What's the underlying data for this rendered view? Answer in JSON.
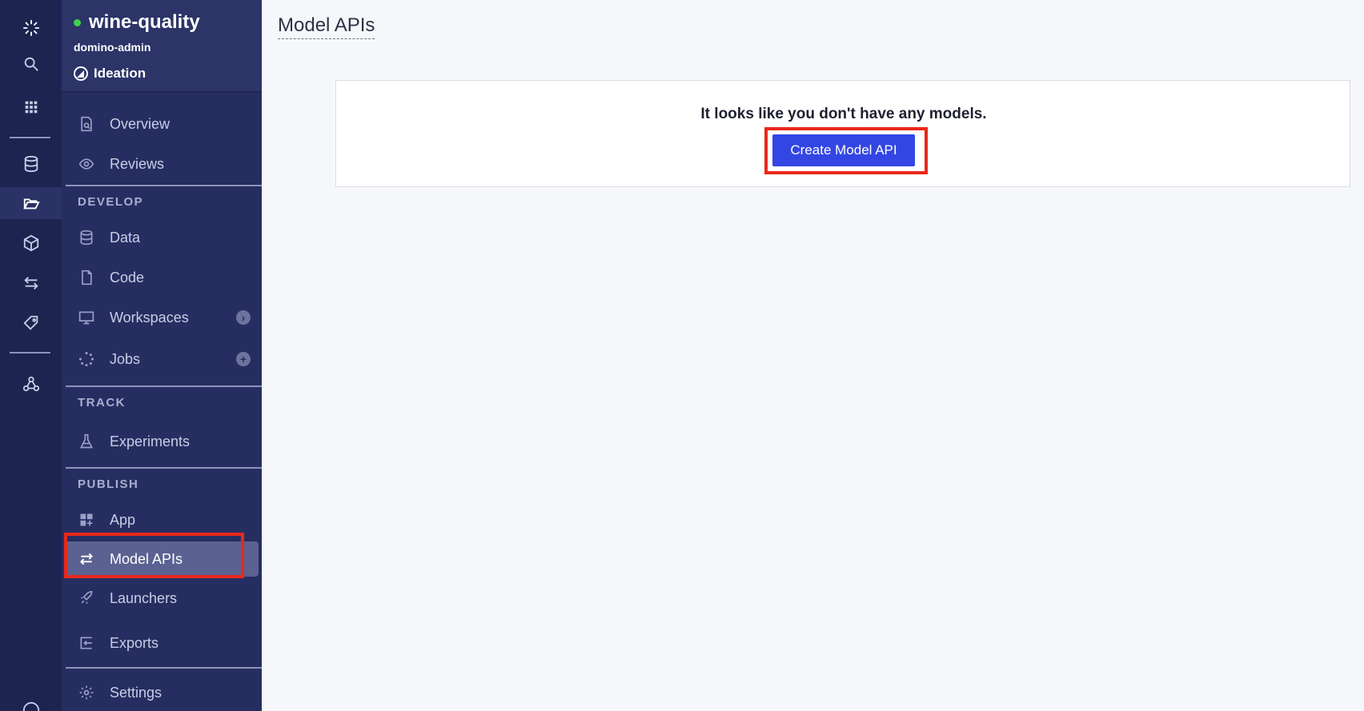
{
  "rail": {
    "items": [
      {
        "icon": "domino-logo-icon"
      },
      {
        "icon": "search-icon"
      },
      {
        "icon": "grid-apps-icon"
      },
      {
        "icon": "database-icon"
      },
      {
        "icon": "folder-open-icon"
      },
      {
        "icon": "cube-icon"
      },
      {
        "icon": "swap-arrows-icon"
      },
      {
        "icon": "tag-icon"
      },
      {
        "icon": "nodes-icon"
      }
    ]
  },
  "project": {
    "name": "wine-quality",
    "status_color": "#3dd24f",
    "owner": "domino-admin",
    "stage": "Ideation"
  },
  "sidebar": {
    "top": [
      {
        "label": "Overview",
        "icon": "document-search-icon"
      },
      {
        "label": "Reviews",
        "icon": "eye-icon"
      }
    ],
    "develop": {
      "header": "DEVELOP",
      "items": [
        {
          "label": "Data",
          "icon": "database-icon"
        },
        {
          "label": "Code",
          "icon": "file-icon"
        },
        {
          "label": "Workspaces",
          "icon": "monitor-icon",
          "trail": "›"
        },
        {
          "label": "Jobs",
          "icon": "spinner-dots-icon",
          "trail": "+"
        }
      ]
    },
    "track": {
      "header": "TRACK",
      "items": [
        {
          "label": "Experiments",
          "icon": "flask-icon"
        }
      ]
    },
    "publish": {
      "header": "PUBLISH",
      "items": [
        {
          "label": "App",
          "icon": "app-grid-icon"
        },
        {
          "label": "Model APIs",
          "icon": "swap-arrows-icon"
        },
        {
          "label": "Launchers",
          "icon": "rocket-icon"
        },
        {
          "label": "Exports",
          "icon": "export-icon"
        }
      ]
    },
    "bottom": [
      {
        "label": "Settings",
        "icon": "gear-icon"
      }
    ]
  },
  "main": {
    "title": "Model APIs",
    "empty_message": "It looks like you don't have any models.",
    "create_button": "Create Model API"
  },
  "colors": {
    "accent": "#3346e4",
    "highlight": "#e8281b",
    "sidebar_bg": "#262e61",
    "rail_bg": "#1d2450"
  }
}
